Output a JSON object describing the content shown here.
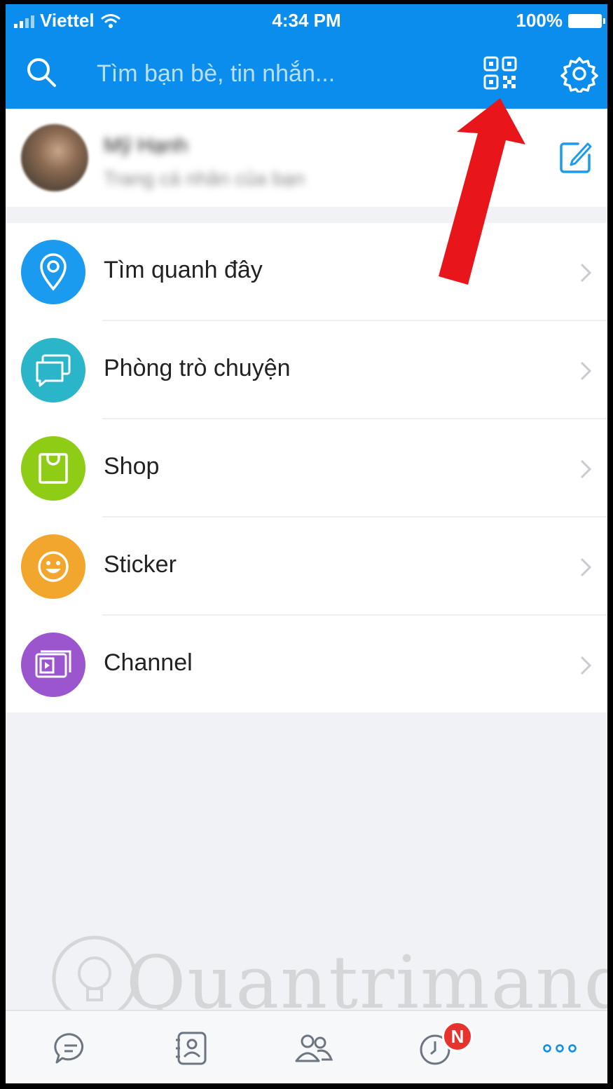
{
  "status_bar": {
    "carrier": "Viettel",
    "time": "4:34 PM",
    "battery": "100%"
  },
  "search": {
    "placeholder": "Tìm bạn bè, tin nhắn..."
  },
  "profile": {
    "name": "Mỹ Hạnh",
    "subtitle": "Trang cá nhân của bạn"
  },
  "menu": {
    "items": [
      {
        "label": "Tìm quanh đây",
        "icon": "location-pin-icon",
        "color": "#1a9bf0"
      },
      {
        "label": "Phòng trò chuyện",
        "icon": "chat-room-icon",
        "color": "#2bb5c9"
      },
      {
        "label": "Shop",
        "icon": "shopping-bag-icon",
        "color": "#8fcc15"
      },
      {
        "label": "Sticker",
        "icon": "smiley-icon",
        "color": "#f3a62e"
      },
      {
        "label": "Channel",
        "icon": "video-channel-icon",
        "color": "#9b55cf"
      }
    ]
  },
  "bottom_nav": {
    "items": [
      "messages-icon",
      "contacts-icon",
      "groups-icon",
      "timeline-icon",
      "more-icon"
    ],
    "badge": "N",
    "active": "more-icon"
  },
  "colors": {
    "primary": "#0a8ded",
    "arrow": "#e8161b"
  },
  "watermark": "Quantrimang"
}
